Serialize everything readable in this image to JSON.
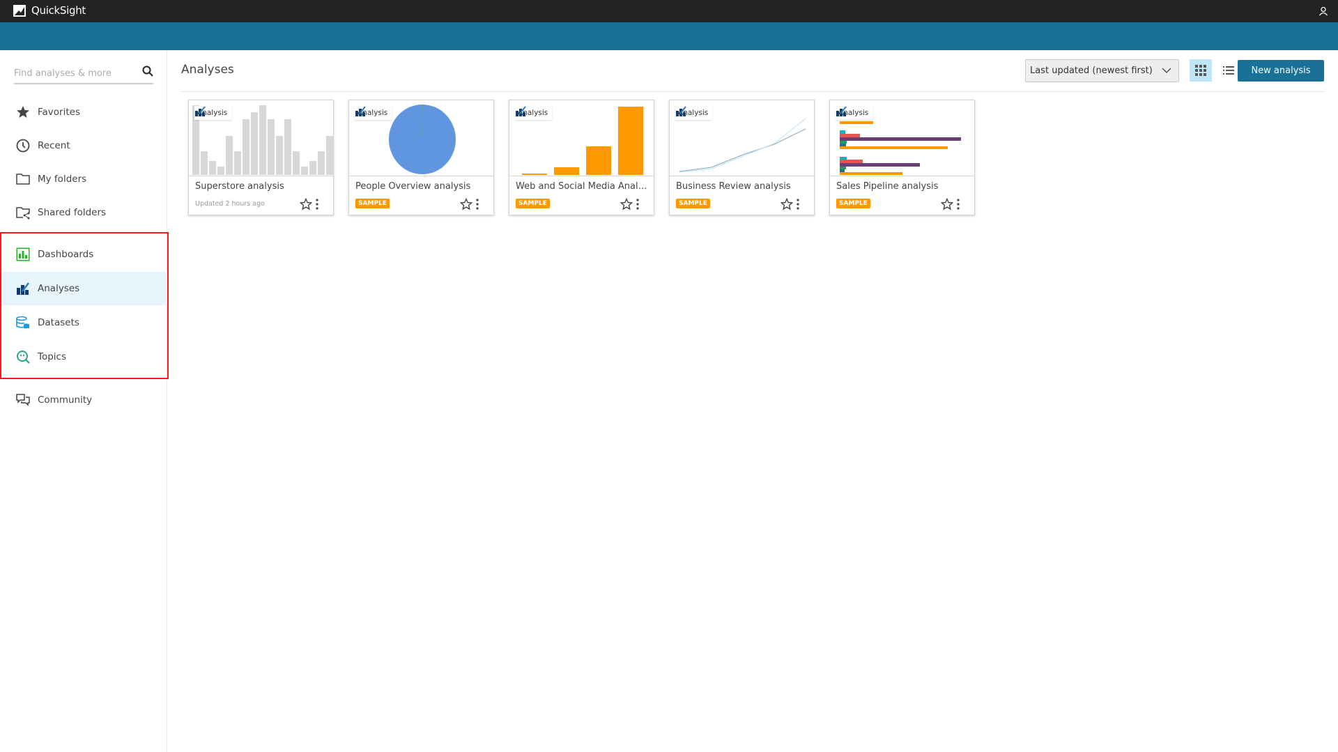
{
  "app": {
    "title": "QuickSight"
  },
  "search": {
    "placeholder": "Find analyses & more"
  },
  "sidebar": {
    "items": [
      {
        "label": "Favorites",
        "icon": "star-icon"
      },
      {
        "label": "Recent",
        "icon": "clock-icon"
      },
      {
        "label": "My folders",
        "icon": "folder-icon"
      },
      {
        "label": "Shared folders",
        "icon": "shared-folder-icon"
      },
      {
        "label": "Dashboards",
        "icon": "dashboard-icon"
      },
      {
        "label": "Analyses",
        "icon": "analysis-icon",
        "active": true
      },
      {
        "label": "Datasets",
        "icon": "dataset-icon"
      },
      {
        "label": "Topics",
        "icon": "topics-icon"
      },
      {
        "label": "Community",
        "icon": "community-icon"
      }
    ]
  },
  "main": {
    "title": "Analyses",
    "sort": {
      "selected": "Last updated (newest first)"
    },
    "view": "grid",
    "new_button": "New analysis",
    "cards": [
      {
        "tag": "Analysis",
        "name": "Superstore analysis",
        "meta": "Updated 2 hours ago"
      },
      {
        "tag": "Analysis",
        "name": "People Overview analysis",
        "badge": "SAMPLE"
      },
      {
        "tag": "Analysis",
        "name": "Web and Social Media Analytics analysis",
        "badge": "SAMPLE"
      },
      {
        "tag": "Analysis",
        "name": "Business Review analysis",
        "badge": "SAMPLE"
      },
      {
        "tag": "Analysis",
        "name": "Sales Pipeline analysis",
        "badge": "SAMPLE"
      }
    ]
  },
  "colors": {
    "topbar": "#232323",
    "band": "#1a7198",
    "accent": "#1a7198",
    "sample": "#ff9900",
    "highlight": "#ff1a1a"
  }
}
